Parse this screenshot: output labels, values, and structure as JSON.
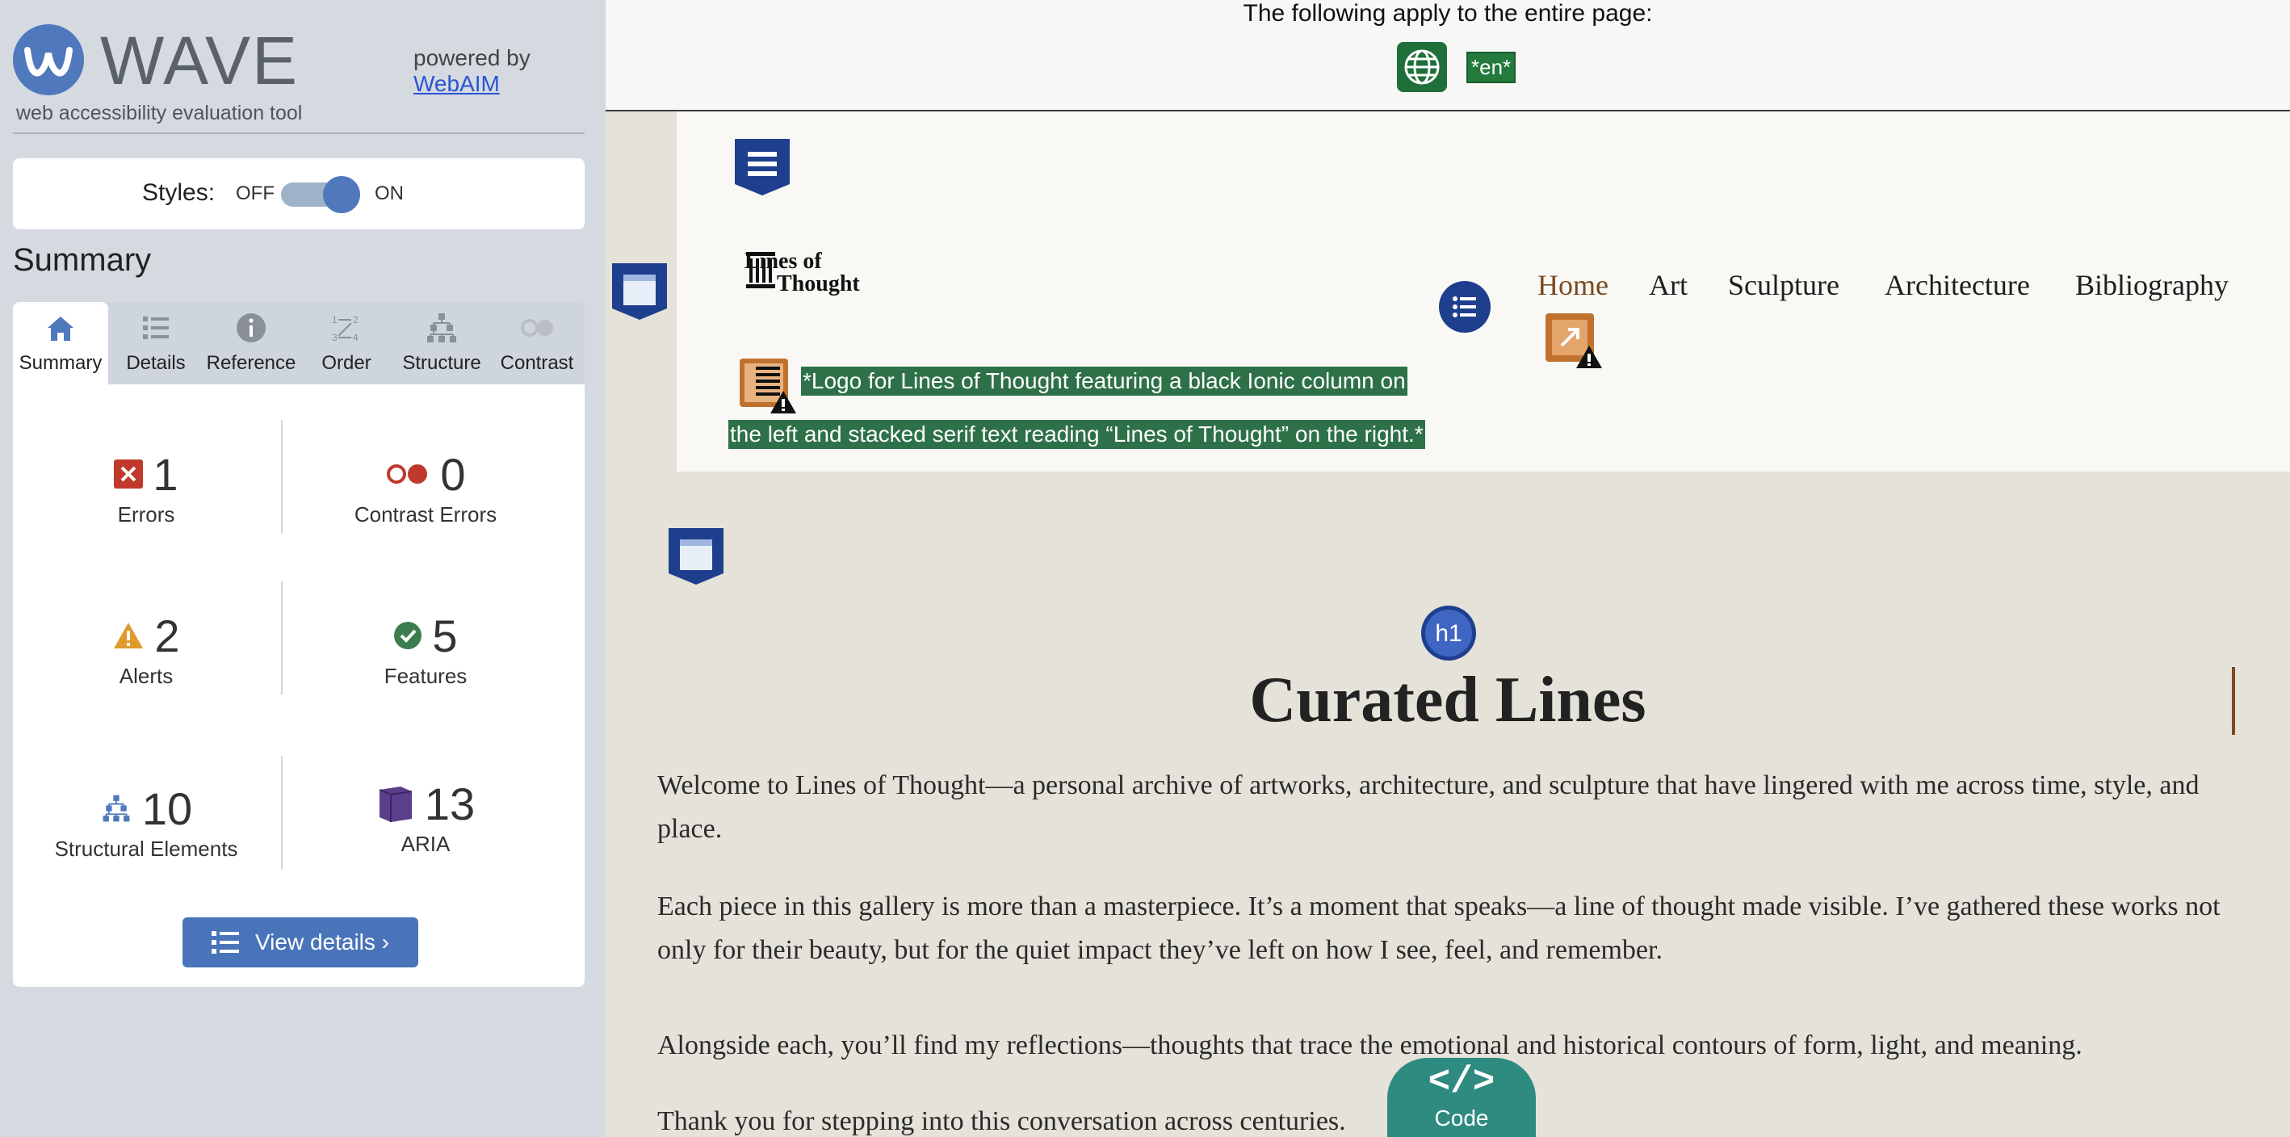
{
  "sidebar": {
    "logo_word": "WAVE",
    "logo_tagline": "web accessibility evaluation tool",
    "powered_by": "powered by",
    "powered_link": "WebAIM",
    "styles_label": "Styles:",
    "styles_off": "OFF",
    "styles_on": "ON",
    "summary_title": "Summary",
    "tabs": [
      {
        "label": "Summary",
        "icon": "home-icon"
      },
      {
        "label": "Details",
        "icon": "list-icon"
      },
      {
        "label": "Reference",
        "icon": "info-icon"
      },
      {
        "label": "Order",
        "icon": "order-icon"
      },
      {
        "label": "Structure",
        "icon": "structure-icon"
      },
      {
        "label": "Contrast",
        "icon": "contrast-icon"
      }
    ],
    "stats": {
      "errors": {
        "value": "1",
        "label": "Errors"
      },
      "contrast_errors": {
        "value": "0",
        "label": "Contrast Errors"
      },
      "alerts": {
        "value": "2",
        "label": "Alerts"
      },
      "features": {
        "value": "5",
        "label": "Features"
      },
      "structural": {
        "value": "10",
        "label": "Structural Elements"
      },
      "aria": {
        "value": "13",
        "label": "ARIA"
      }
    },
    "view_details": "View details ›"
  },
  "page": {
    "apply_text": "The following apply to the entire page:",
    "lang_badge": "*en*",
    "brand_line1": "Lines of",
    "brand_line2": "Thought",
    "nav": [
      "Home",
      "Art",
      "Sculpture",
      "Architecture",
      "Bibliography"
    ],
    "logo_alt_line1": "*Logo for Lines of Thought featuring a black Ionic column on",
    "logo_alt_line2": "the left and stacked serif text reading “Lines of Thought” on the right.*",
    "h1_badge": "h1",
    "title": "Curated Lines",
    "paragraphs": [
      "Welcome to Lines of Thought—a personal archive of artworks, architecture, and sculpture that have lingered with me across time, style, and place.",
      "Each piece in this gallery is more than a masterpiece. It’s a moment that speaks—a line of thought made visible. I’ve gathered these works not only for their beauty, but for the quiet impact they’ve left on how I see, feel, and remember.",
      "Alongside each, you’ll find my reflections—thoughts that trace the emotional and historical contours of form, light, and meaning.",
      "Thank you for stepping into this conversation across centuries."
    ],
    "code_glyph": "</>",
    "code_label": "Code"
  },
  "colors": {
    "accent": "#4f78bd",
    "error": "#c0392b",
    "alert": "#e09a2b",
    "feature": "#3b7d4f",
    "aria": "#5b3f8c",
    "nav_active": "#7a4a22"
  }
}
